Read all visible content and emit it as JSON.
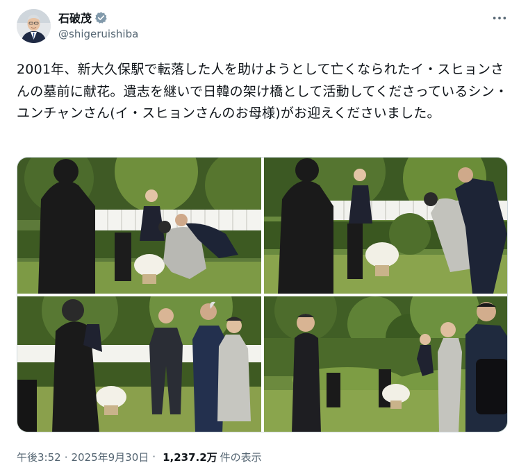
{
  "author": {
    "display_name": "石破茂",
    "handle": "@shigeruishiba",
    "verified_badge_color": "#829aab"
  },
  "more_icon": "more-horizontal-icon",
  "tweet": {
    "text": "2001年、新大久保駅で転落した人を助けようとして亡くなられたイ・スヒョンさんの墓前に献花。遺志を継いで日韓の架け橋として活動してくださっているシン・ユンチャンさん(イ・スヒョンさんのお母様)がお迎えくださいました。"
  },
  "media": {
    "photo_count": 4
  },
  "meta": {
    "time": "午後3:52",
    "separator": "·",
    "date": "2025年9月30日",
    "views_count": "1,237.2万",
    "views_label": "件の表示"
  },
  "colors": {
    "text_primary": "#0f1419",
    "text_secondary": "#536471",
    "border": "#cfd9de"
  }
}
